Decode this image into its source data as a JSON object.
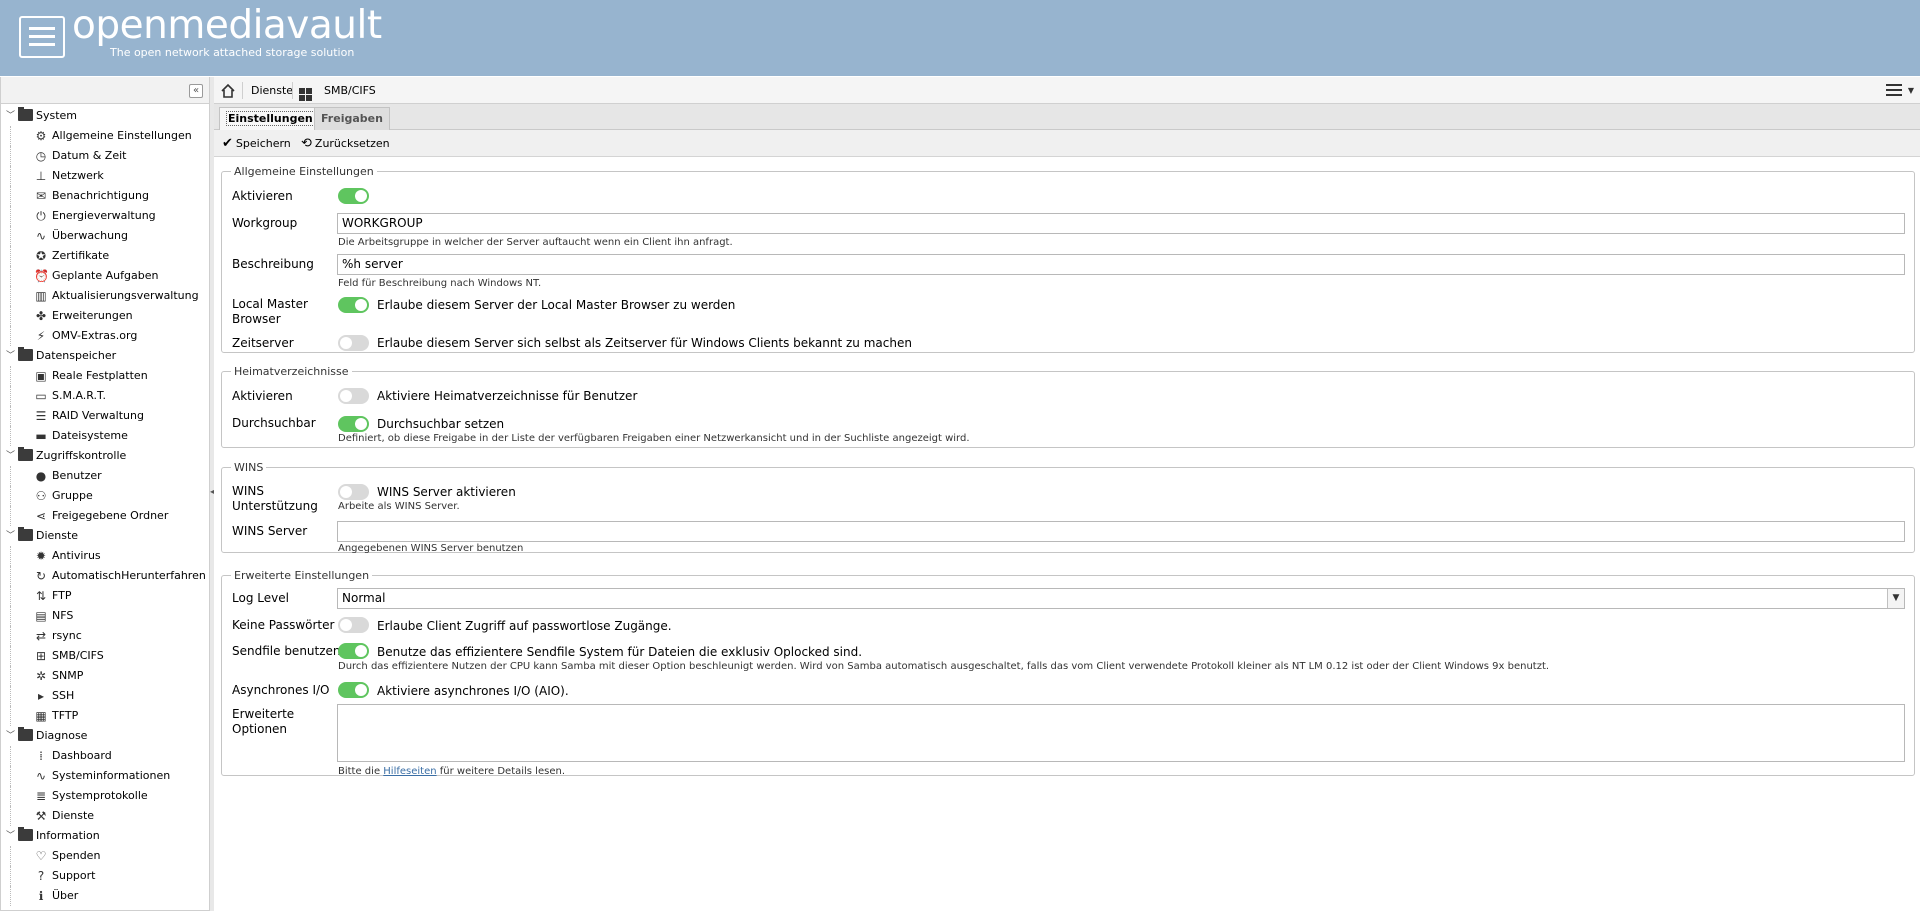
{
  "header": {
    "logo": "openmediavault",
    "tagline": "The open network attached storage solution"
  },
  "sidebar": {
    "collapse_icon": "double-chevron-left-icon",
    "groups": [
      {
        "label": "System",
        "items": [
          {
            "label": "Allgemeine Einstellungen",
            "icon": "gears-icon"
          },
          {
            "label": "Datum & Zeit",
            "icon": "clock-icon"
          },
          {
            "label": "Netzwerk",
            "icon": "network-icon"
          },
          {
            "label": "Benachrichtigung",
            "icon": "envelope-icon"
          },
          {
            "label": "Energieverwaltung",
            "icon": "power-icon"
          },
          {
            "label": "Überwachung",
            "icon": "line-chart-icon"
          },
          {
            "label": "Zertifikate",
            "icon": "certificate-icon"
          },
          {
            "label": "Geplante Aufgaben",
            "icon": "alarm-icon"
          },
          {
            "label": "Aktualisierungsverwaltung",
            "icon": "trash-icon"
          },
          {
            "label": "Erweiterungen",
            "icon": "puzzle-icon"
          },
          {
            "label": "OMV-Extras.org",
            "icon": "plug-icon"
          }
        ]
      },
      {
        "label": "Datenspeicher",
        "items": [
          {
            "label": "Reale Festplatten",
            "icon": "disk-icon"
          },
          {
            "label": "S.M.A.R.T.",
            "icon": "monitor-icon"
          },
          {
            "label": "RAID Verwaltung",
            "icon": "database-icon"
          },
          {
            "label": "Dateisysteme",
            "icon": "folder-icon"
          }
        ]
      },
      {
        "label": "Zugriffskontrolle",
        "items": [
          {
            "label": "Benutzer",
            "icon": "user-icon"
          },
          {
            "label": "Gruppe",
            "icon": "users-icon"
          },
          {
            "label": "Freigegebene Ordner",
            "icon": "share-icon"
          }
        ]
      },
      {
        "label": "Dienste",
        "items": [
          {
            "label": "Antivirus",
            "icon": "bug-icon"
          },
          {
            "label": "AutomatischHerunterfahren",
            "icon": "power-cycle-icon"
          },
          {
            "label": "FTP",
            "icon": "ftp-icon"
          },
          {
            "label": "NFS",
            "icon": "file-icon"
          },
          {
            "label": "rsync",
            "icon": "sync-icon"
          },
          {
            "label": "SMB/CIFS",
            "icon": "windows-icon"
          },
          {
            "label": "SNMP",
            "icon": "snmp-icon"
          },
          {
            "label": "SSH",
            "icon": "terminal-icon"
          },
          {
            "label": "TFTP",
            "icon": "tftp-icon"
          }
        ]
      },
      {
        "label": "Diagnose",
        "items": [
          {
            "label": "Dashboard",
            "icon": "dashboard-icon"
          },
          {
            "label": "Systeminformationen",
            "icon": "line-chart-icon"
          },
          {
            "label": "Systemprotokolle",
            "icon": "log-icon"
          },
          {
            "label": "Dienste",
            "icon": "wrench-icon"
          }
        ]
      },
      {
        "label": "Information",
        "items": [
          {
            "label": "Spenden",
            "icon": "heart-icon"
          },
          {
            "label": "Support",
            "icon": "question-icon"
          },
          {
            "label": "Über",
            "icon": "info-icon"
          }
        ]
      }
    ]
  },
  "breadcrumb": {
    "home_icon": "home-icon",
    "items": [
      "Dienste",
      "SMB/CIFS"
    ]
  },
  "tabs": [
    "Einstellungen",
    "Freigaben"
  ],
  "toolbar": {
    "save": "Speichern",
    "reset": "Zurücksetzen"
  },
  "sections": {
    "general": {
      "title": "Allgemeine Einstellungen",
      "enable_label": "Aktivieren",
      "enable_on": true,
      "workgroup_label": "Workgroup",
      "workgroup_value": "WORKGROUP",
      "workgroup_hint": "Die Arbeitsgruppe in welcher der Server auftaucht wenn ein Client ihn anfragt.",
      "description_label": "Beschreibung",
      "description_value": "%h server",
      "description_hint": "Feld für Beschreibung nach Windows NT.",
      "lmb_label_1": "Local Master",
      "lmb_label_2": "Browser",
      "lmb_on": true,
      "lmb_text": "Erlaube diesem Server der Local Master Browser zu werden",
      "timeserver_label": "Zeitserver",
      "timeserver_on": false,
      "timeserver_text": "Erlaube diesem Server sich selbst als Zeitserver für Windows Clients bekannt zu machen"
    },
    "homes": {
      "title": "Heimatverzeichnisse",
      "enable_label": "Aktivieren",
      "enable_on": false,
      "enable_text": "Aktiviere Heimatverzeichnisse für Benutzer",
      "browsable_label": "Durchsuchbar",
      "browsable_on": true,
      "browsable_text": "Durchsuchbar setzen",
      "browsable_hint": "Definiert, ob diese Freigabe in der Liste der verfügbaren Freigaben einer Netzwerkansicht und in der Suchliste angezeigt wird."
    },
    "wins": {
      "title": "WINS",
      "support_label_1": "WINS",
      "support_label_2": "Unterstützung",
      "support_on": false,
      "support_text": "WINS Server aktivieren",
      "support_hint": "Arbeite als WINS Server.",
      "server_label": "WINS Server",
      "server_value": "",
      "server_hint": "Angegebenen WINS Server benutzen"
    },
    "advanced": {
      "title": "Erweiterte Einstellungen",
      "loglevel_label": "Log Level",
      "loglevel_value": "Normal",
      "nopass_label": "Keine Passwörter",
      "nopass_on": false,
      "nopass_text": "Erlaube Client Zugriff auf passwortlose Zugänge.",
      "sendfile_label": "Sendfile benutzen",
      "sendfile_on": true,
      "sendfile_text": "Benutze das effizientere Sendfile System für Dateien die exklusiv Oplocked sind.",
      "sendfile_hint": "Durch das effizientere Nutzen der CPU kann Samba mit dieser Option beschleunigt werden. Wird von Samba automatisch ausgeschaltet, falls das vom Client verwendete Protokoll kleiner als NT LM 0.12 ist oder der Client Windows 9x benutzt.",
      "aio_label": "Asynchrones I/O",
      "aio_on": true,
      "aio_text": "Aktiviere asynchrones I/O (AIO).",
      "extra_label_1": "Erweiterte",
      "extra_label_2": "Optionen",
      "extra_value": "",
      "extra_hint_pre": "Bitte die",
      "extra_hint_link": "Hilfeseiten",
      "extra_hint_post": "für weitere Details lesen."
    }
  }
}
